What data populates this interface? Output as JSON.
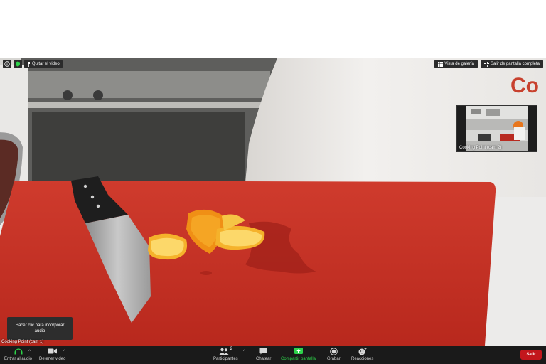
{
  "top_bar": {
    "stop_video_label": "Quitar el video",
    "gallery_view_label": "Vista de galería",
    "exit_fullscreen_label": "Salir de pantalla completa"
  },
  "thumbnail": {
    "label": "Cooking Point (cam 2)"
  },
  "main_video": {
    "label": "Cooking Point (cam 1)",
    "wall_text": "Co"
  },
  "audio_tooltip": {
    "line1": "Hacer clic para incorporar",
    "line2": "audio"
  },
  "toolbar": {
    "join_audio": "Entrar al audio",
    "stop_video": "Detener video",
    "participants": "Participantes",
    "participants_count": "2",
    "chat": "Chatear",
    "share_screen": "Compartir pantalla",
    "record": "Grabar",
    "reactions": "Reacciones",
    "leave": "Salir"
  },
  "colors": {
    "toolbar_bg": "#1a1a1a",
    "leave_red": "#c3161c",
    "share_green": "#2dd34a"
  }
}
